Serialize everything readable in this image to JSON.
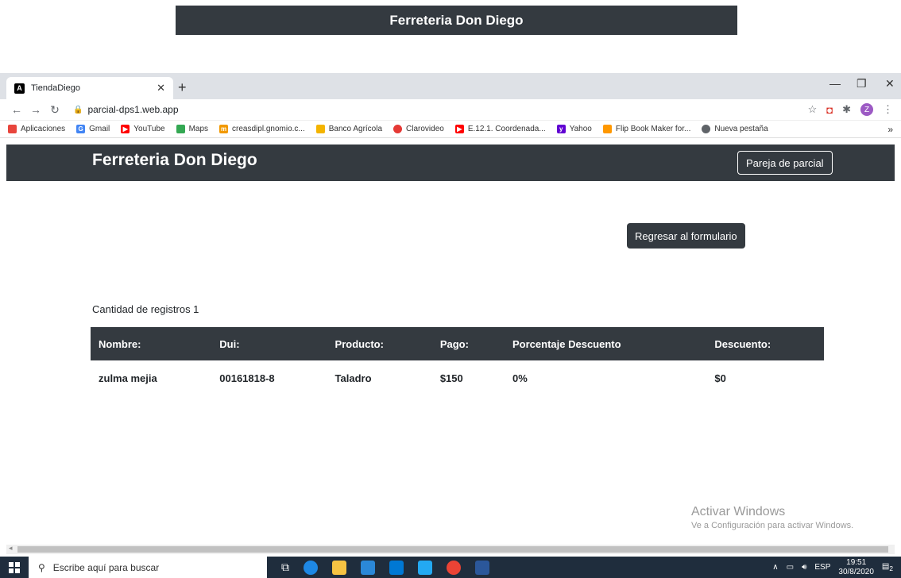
{
  "banner": {
    "title": "Ferreteria Don Diego"
  },
  "browser": {
    "tab_title": "TiendaDiego",
    "favicon_letter": "A",
    "url": "parcial-dps1.web.app",
    "profile_initial": "Z",
    "bookmarks": [
      {
        "label": "Aplicaciones",
        "color": "#e8453c"
      },
      {
        "label": "Gmail",
        "color": "#4285f4"
      },
      {
        "label": "YouTube",
        "color": "#ff0000"
      },
      {
        "label": "Maps",
        "color": "#34a853"
      },
      {
        "label": "creasdipl.gnomio.c...",
        "color": "#f29900"
      },
      {
        "label": "Banco Agrícola",
        "color": "#f4b400"
      },
      {
        "label": "Clarovideo",
        "color": "#e53935"
      },
      {
        "label": "E.12.1. Coordenada...",
        "color": "#ff0000"
      },
      {
        "label": "Yahoo",
        "color": "#6001d2"
      },
      {
        "label": "Flip Book Maker for...",
        "color": "#ff9800"
      },
      {
        "label": "Nueva pestaña",
        "color": "#5f6368"
      }
    ]
  },
  "app": {
    "brand": "Ferreteria Don Diego",
    "pareja_button": "Pareja de parcial",
    "regresar_button": "Regresar al formulario",
    "record_count_label": "Cantidad de registros 1",
    "table": {
      "headers": [
        "Nombre:",
        "Dui:",
        "Producto:",
        "Pago:",
        "Porcentaje Descuento",
        "Descuento:"
      ],
      "rows": [
        [
          "zulma mejia",
          "00161818-8",
          "Taladro",
          "$150",
          "0%",
          "$0"
        ]
      ]
    }
  },
  "watermark": {
    "line1": "Activar Windows",
    "line2": "Ve a Configuración para activar Windows."
  },
  "taskbar": {
    "search_placeholder": "Escribe aquí para buscar",
    "language": "ESP",
    "time": "19:51",
    "date": "30/8/2020",
    "notification_count": "2"
  }
}
